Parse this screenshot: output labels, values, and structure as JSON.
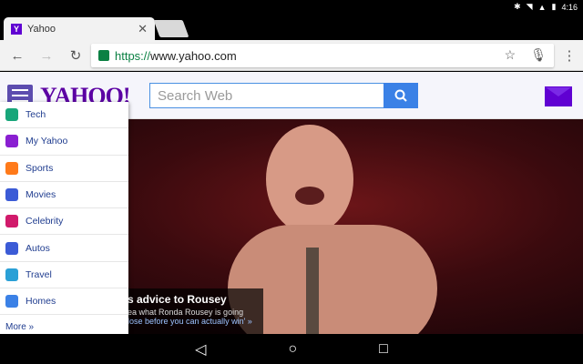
{
  "status_bar": {
    "time": "4:16"
  },
  "tab": {
    "favicon": "Y",
    "title": "Yahoo"
  },
  "omnibox": {
    "scheme": "https://",
    "host": "www.yahoo.com"
  },
  "header": {
    "logo": "YAHOO!",
    "search_placeholder": "Search Web"
  },
  "menu": {
    "items": [
      {
        "label": "Tech",
        "icon": "tech-icon",
        "color": "#18a67a"
      },
      {
        "label": "My Yahoo",
        "icon": "my-yahoo-icon",
        "color": "#8a1fd1"
      },
      {
        "label": "Sports",
        "icon": "sports-icon",
        "color": "#ff7a1a"
      },
      {
        "label": "Movies",
        "icon": "movies-icon",
        "color": "#3b5bd6"
      },
      {
        "label": "Celebrity",
        "icon": "celebrity-icon",
        "color": "#d11a6b"
      },
      {
        "label": "Autos",
        "icon": "autos-icon",
        "color": "#3b5bd6"
      },
      {
        "label": "Travel",
        "icon": "travel-icon",
        "color": "#2aa0d6"
      },
      {
        "label": "Homes",
        "icon": "homes-icon",
        "color": "#3b81e6"
      }
    ],
    "more": "More »"
  },
  "hero": {
    "headline": "s advice to Rousey",
    "sub1": "ea what Ronda Rousey is going",
    "sub2": "lose before you can actually win' »"
  },
  "colors": {
    "brand": "#6001d2",
    "accent": "#3b81e6",
    "secure": "#0b8043"
  }
}
